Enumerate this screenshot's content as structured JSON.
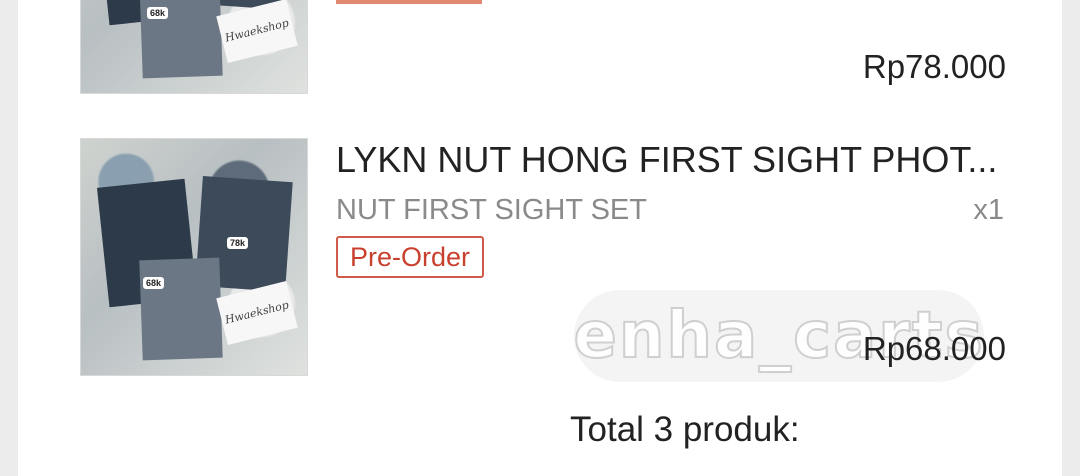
{
  "items": [
    {
      "price": "Rp78.000",
      "image_tags": [
        "68k"
      ],
      "image_note": "Hwaekshop"
    },
    {
      "title": "LYKN NUT HONG FIRST SIGHT PHOT...",
      "variant": "NUT FIRST SIGHT SET",
      "quantity": "x1",
      "badge": "Pre-Order",
      "price": "Rp68.000",
      "image_tags": [
        "78k",
        "68k"
      ],
      "image_note": "Hwaekshop"
    }
  ],
  "summary": {
    "total_label": "Total 3 produk:"
  },
  "watermark": "enha_carts",
  "colors": {
    "badge": "#c8412f",
    "text": "#222222",
    "muted": "#8a8a8a"
  }
}
